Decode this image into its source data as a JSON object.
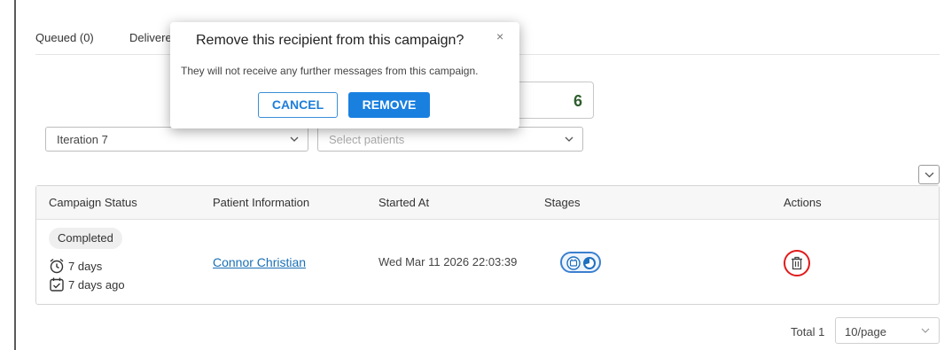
{
  "tabs": [
    "Queued (0)",
    "Delivered"
  ],
  "count": "6",
  "filters": {
    "iteration": "Iteration 7",
    "patients_placeholder": "Select patients"
  },
  "table": {
    "headers": [
      "Campaign Status",
      "Patient Information",
      "Started At",
      "Stages",
      "Actions"
    ],
    "row": {
      "status": "Completed",
      "duration": "7 days",
      "completed_ago": "7 days ago",
      "patient": "Connor Christian",
      "started_at": "Wed Mar 11 2026 22:03:39"
    }
  },
  "pagination": {
    "total": "Total 1",
    "page_size": "10/page"
  },
  "modal": {
    "title": "Remove this recipient from this campaign?",
    "close": "×",
    "message": "They will not receive any further messages from this campaign.",
    "cancel_label": "CANCEL",
    "remove_label": "REMOVE"
  },
  "colors": {
    "primary": "#1a80e0",
    "highlight": "#e01b1b",
    "count": "#2e5e2e"
  }
}
